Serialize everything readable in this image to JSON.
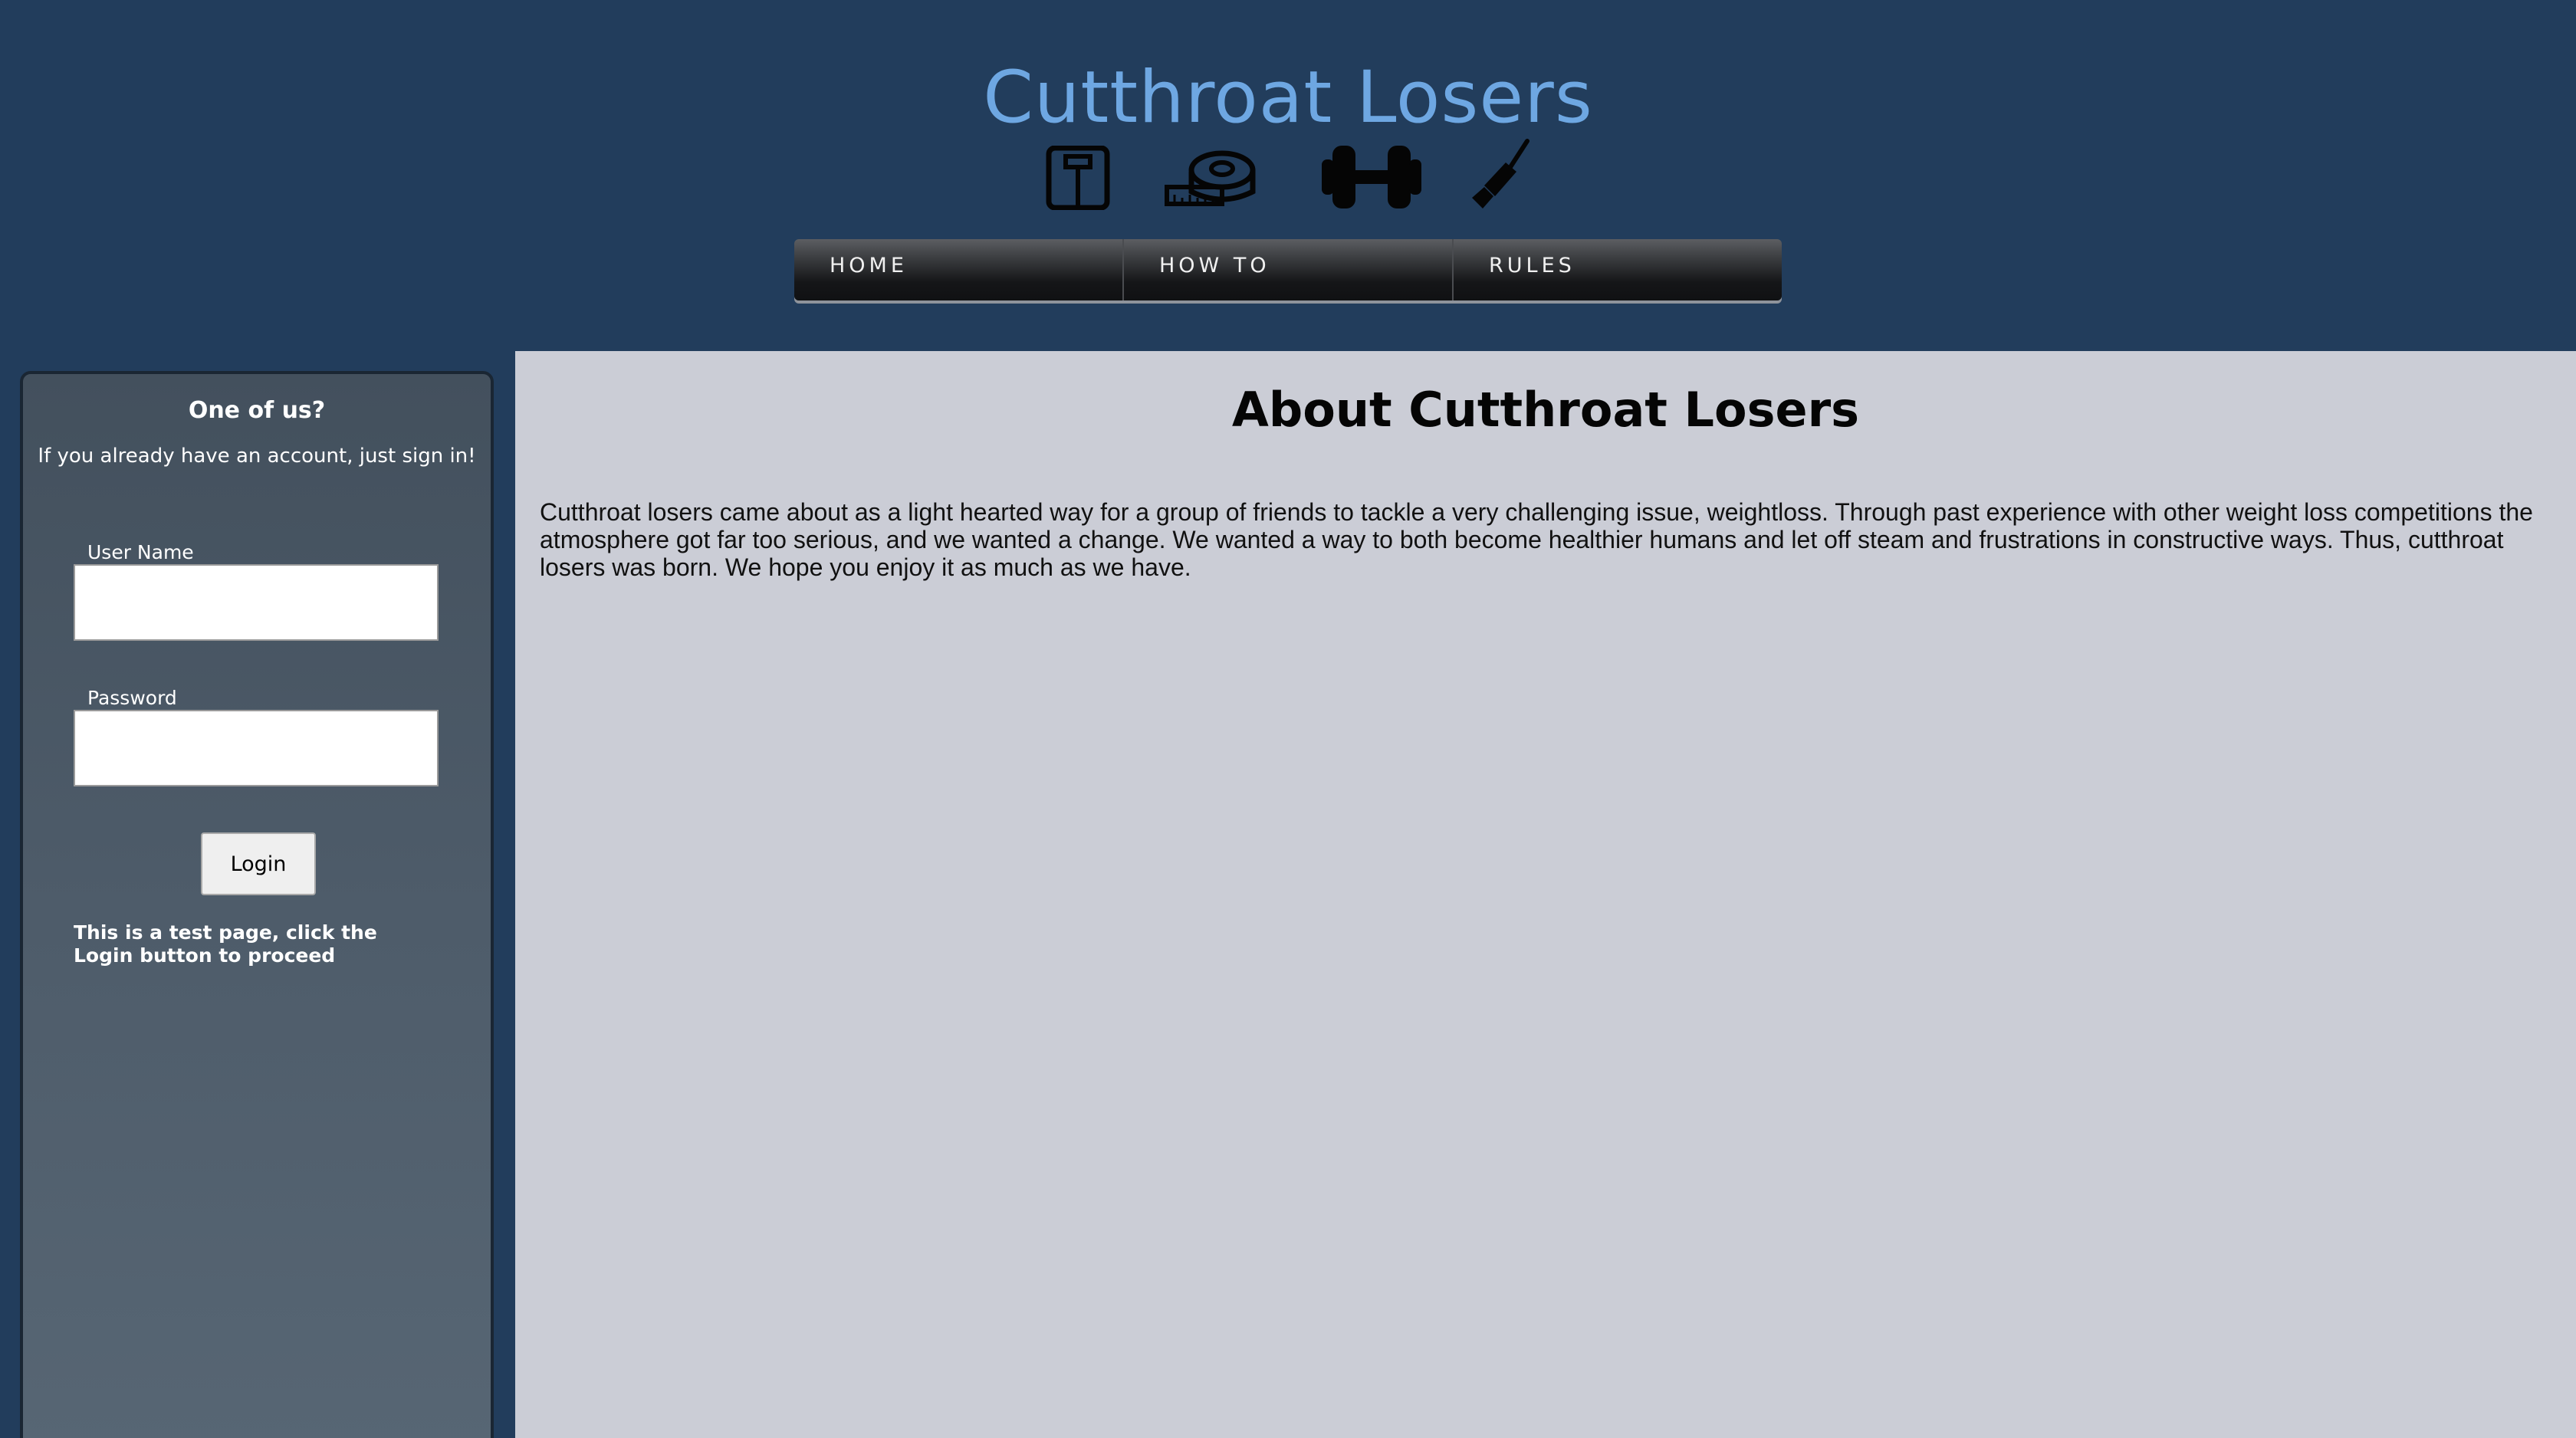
{
  "header": {
    "title": "Cutthroat Losers",
    "title_color": "#6ea7e2",
    "icons": [
      "scale-icon",
      "tape-measure-icon",
      "dumbbell-icon",
      "knife-icon"
    ]
  },
  "nav": {
    "items": [
      {
        "label": "HOME"
      },
      {
        "label": "HOW TO"
      },
      {
        "label": "RULES"
      }
    ]
  },
  "sidebar": {
    "heading": "One of us?",
    "subheading": "If you already have an account, just sign in!",
    "username_label": "User Name",
    "username_value": "",
    "password_label": "Password",
    "password_value": "",
    "login_label": "Login",
    "note": "This is a test page, click the Login button to proceed"
  },
  "main": {
    "title": "About Cutthroat Losers",
    "body": "Cutthroat losers came about as a light hearted way for a group of friends to tackle a very challenging issue, weightloss. Through past experience with other weight loss competitions the atmosphere got far too serious, and we wanted a change. We wanted a way to both become healthier humans and let off steam and frustrations in constructive ways. Thus, cutthroat losers was born. We hope you enjoy it as much as we have."
  },
  "colors": {
    "background": "#223d5c",
    "content_background": "#cbcdd6"
  }
}
